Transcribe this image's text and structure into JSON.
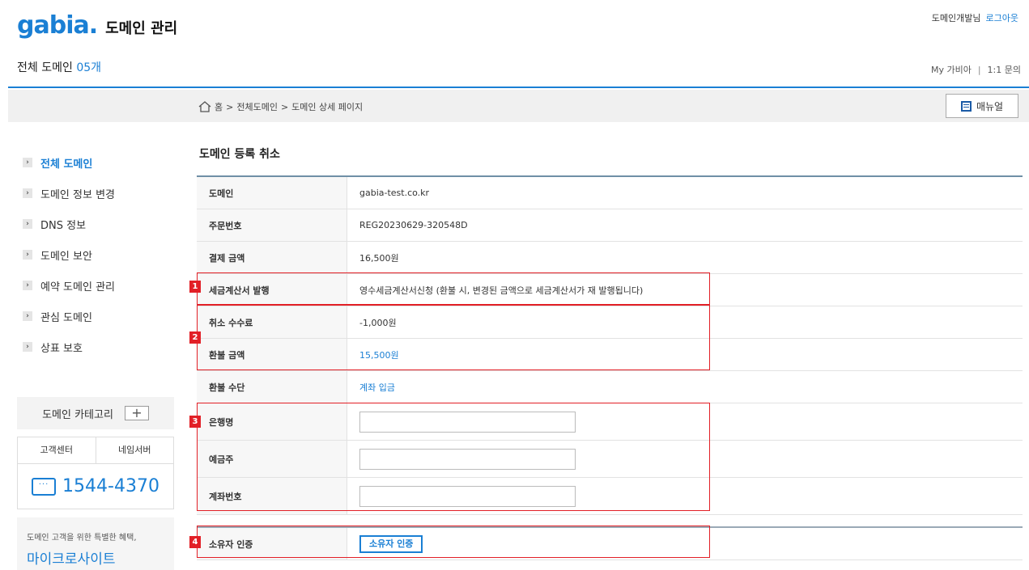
{
  "header": {
    "brand": "gabia.",
    "app_title": "도메인 관리",
    "user_label": "도메인개발님",
    "logout": "로그아웃",
    "total_label": "전체 도메인",
    "total_count": "05개",
    "link_mygabia": "My 가비아",
    "link_inquiry": "1:1 문의",
    "separator": "|"
  },
  "breadcrumb": {
    "items": [
      "홈",
      "전체도메인",
      "도메인 상세 페이지"
    ],
    "sep": ">",
    "manual": "매뉴얼"
  },
  "sidebar": {
    "items": [
      {
        "label": "전체 도메인"
      },
      {
        "label": "도메인 정보 변경"
      },
      {
        "label": "DNS 정보"
      },
      {
        "label": "도메인 보안"
      },
      {
        "label": "예약 도메인 관리"
      },
      {
        "label": "관심 도메인"
      },
      {
        "label": "상표 보호"
      }
    ],
    "category_label": "도메인 카테고리",
    "cs_tab1": "고객센터",
    "cs_tab2": "네임서버",
    "phone": "1544-4370",
    "promo_line1": "도메인 고객을 위한 특별한 혜택,",
    "promo_line2": "마이크로사이트"
  },
  "main": {
    "title": "도메인 등록 취소",
    "rows": [
      {
        "label": "도메인",
        "value": "gabia-test.co.kr"
      },
      {
        "label": "주문번호",
        "value": "REG20230629-320548D"
      },
      {
        "label": "결제 금액",
        "value": "16,500원"
      },
      {
        "label": "세금계산서 발행",
        "value": "영수세금계산서신청 (환불 시, 변경된 금액으로 세금계산서가 재 발행됩니다)"
      },
      {
        "label": "취소 수수료",
        "value": "-1,000원"
      },
      {
        "label": "환불 금액",
        "value": "15,500원"
      },
      {
        "label": "환불 수단",
        "value": "계좌 입금"
      }
    ],
    "input_rows": [
      {
        "label": "은행명",
        "value": ""
      },
      {
        "label": "예금주",
        "value": ""
      },
      {
        "label": "계좌번호",
        "value": ""
      }
    ],
    "auth_label": "소유자 인증",
    "auth_button": "소유자 인증"
  },
  "markers": [
    "1",
    "2",
    "3",
    "4"
  ],
  "colors": {
    "accent": "#1a7fd4",
    "marker": "#e21f26"
  }
}
